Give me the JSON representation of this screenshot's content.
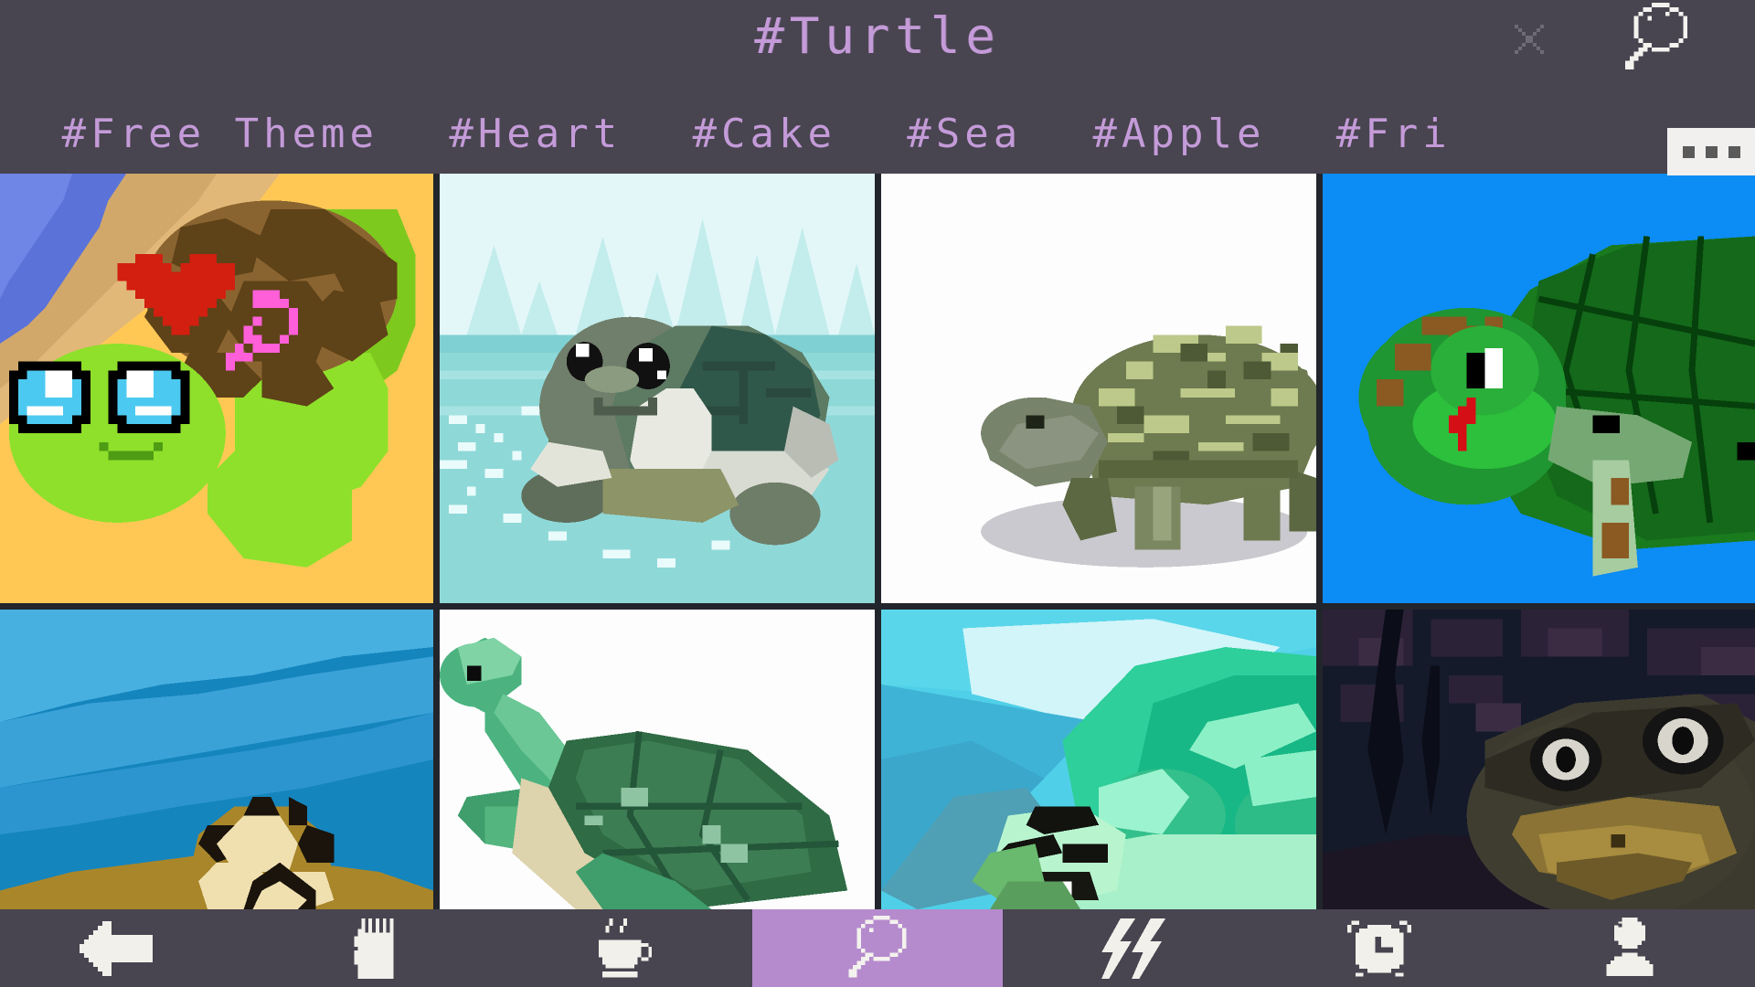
{
  "header": {
    "title": "#Turtle",
    "close_icon": "close-icon",
    "search_icon": "search-icon"
  },
  "tagbar": {
    "tags": [
      {
        "label": "#Free Theme",
        "name": "tag-free-theme"
      },
      {
        "label": "#Heart",
        "name": "tag-heart"
      },
      {
        "label": "#Cake",
        "name": "tag-cake"
      },
      {
        "label": "#Sea",
        "name": "tag-sea"
      },
      {
        "label": "#Apple",
        "name": "tag-apple"
      },
      {
        "label": "#Fri",
        "name": "tag-friend-truncated"
      }
    ]
  },
  "overflow_menu": {
    "label": "...",
    "name": "more-options-button"
  },
  "gallery": {
    "items": [
      {
        "name": "artwork-cute-turtle-heart",
        "alt": "Cute green turtle with red heart on sandy beach"
      },
      {
        "name": "artwork-swimming-turtle",
        "alt": "Pixel turtle swimming in a misty lake"
      },
      {
        "name": "artwork-tortoise-white",
        "alt": "Mossy tortoise walking on white background"
      },
      {
        "name": "artwork-turtle-blue",
        "alt": "Green turtle with brown spots on bright blue"
      },
      {
        "name": "artwork-tortoise-sky",
        "alt": "Tortoise head peeking over sand against blue sky"
      },
      {
        "name": "artwork-sea-turtle-white",
        "alt": "Green sea turtle on white background"
      },
      {
        "name": "artwork-turtle-seascape",
        "alt": "Sea turtle swimming in teal ocean"
      },
      {
        "name": "artwork-turtle-dark-cave",
        "alt": "Turtle face in a dark cave"
      }
    ]
  },
  "nav": {
    "items": [
      {
        "name": "nav-back",
        "icon": "back-arrow-icon",
        "active": false
      },
      {
        "name": "nav-gallery",
        "icon": "sd-card-icon",
        "active": false
      },
      {
        "name": "nav-cafe",
        "icon": "coffee-cup-icon",
        "active": false
      },
      {
        "name": "nav-search",
        "icon": "search-icon",
        "active": true
      },
      {
        "name": "nav-trend",
        "icon": "lightning-icon",
        "active": false
      },
      {
        "name": "nav-alarm",
        "icon": "alarm-clock-icon",
        "active": false
      },
      {
        "name": "nav-profile",
        "icon": "person-icon",
        "active": false
      }
    ],
    "active_color": "#b58bcd"
  },
  "colors": {
    "background": "#484450",
    "accent": "#c49bd8",
    "icon": "#f2f0ea",
    "grid_line": "#22252b"
  }
}
